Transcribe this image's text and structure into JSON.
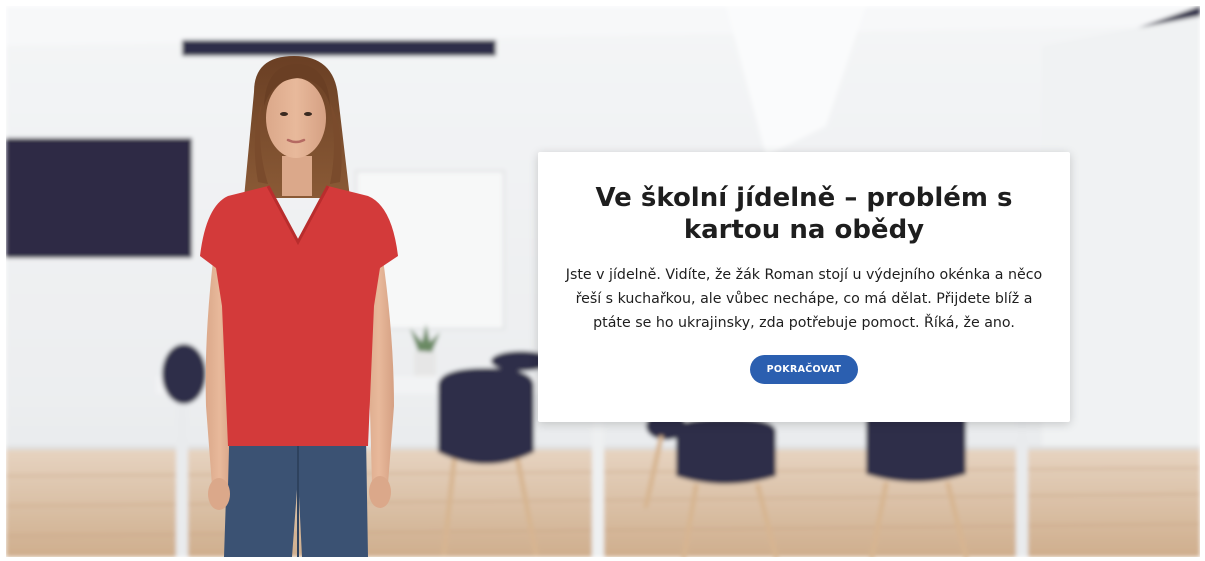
{
  "dialog": {
    "title": "Ve školní jídelně – problém s kartou na obědy",
    "body": "Jste v jídelně. Vidíte, že žák Roman stojí u výdejního okénka a něco řeší s kuchařkou, ale vůbec nechápe, co má dělat. Přijdete blíž a ptáte se ho ukrajinsky, zda potřebuje pomoct. Říká, že ano.",
    "continue_label": "POKRAČOVAT"
  },
  "colors": {
    "button": "#2b5fb0",
    "shirt": "#d33a3a",
    "jeans": "#3b5273",
    "chairs": "#2f2d4a"
  }
}
